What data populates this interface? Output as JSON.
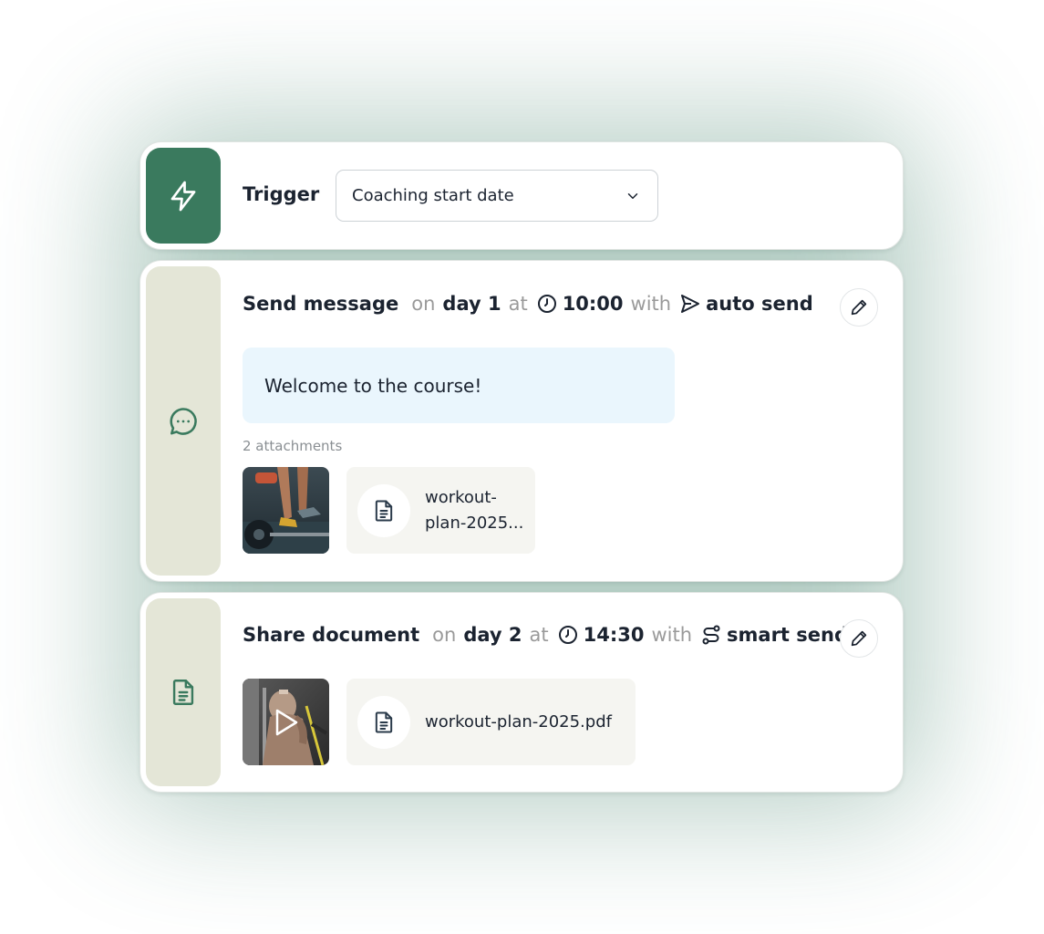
{
  "colors": {
    "accent": "#3a7a5e",
    "side_light": "#e4e6d7",
    "bubble": "#eaf6fd",
    "chip": "#f5f5f1",
    "muted_text": "#9a9a9a"
  },
  "trigger": {
    "label": "Trigger",
    "select_value": "Coaching start date",
    "icon": "lightning-icon"
  },
  "steps": [
    {
      "action": "Send message",
      "on_label": "on",
      "day": "day 1",
      "at_label": "at",
      "time": "10:00",
      "with_label": "with",
      "mode": "auto send",
      "mode_icon": "send-icon",
      "side_icon": "chat-bubble-icon",
      "message": "Welcome to the course!",
      "attachments_label": "2 attachments",
      "attachments": [
        {
          "type": "image",
          "description_icon": "photo-thumbnail"
        },
        {
          "type": "file",
          "name_line1": "workout-",
          "name_line2": "plan-2025..."
        }
      ]
    },
    {
      "action": "Share document",
      "on_label": "on",
      "day": "day 2",
      "at_label": "at",
      "time": "14:30",
      "with_label": "with",
      "mode": "smart send",
      "mode_icon": "route-icon",
      "side_icon": "document-icon",
      "attachments": [
        {
          "type": "video",
          "description_icon": "play-icon"
        },
        {
          "type": "file",
          "name": "workout-plan-2025.pdf"
        }
      ]
    }
  ]
}
